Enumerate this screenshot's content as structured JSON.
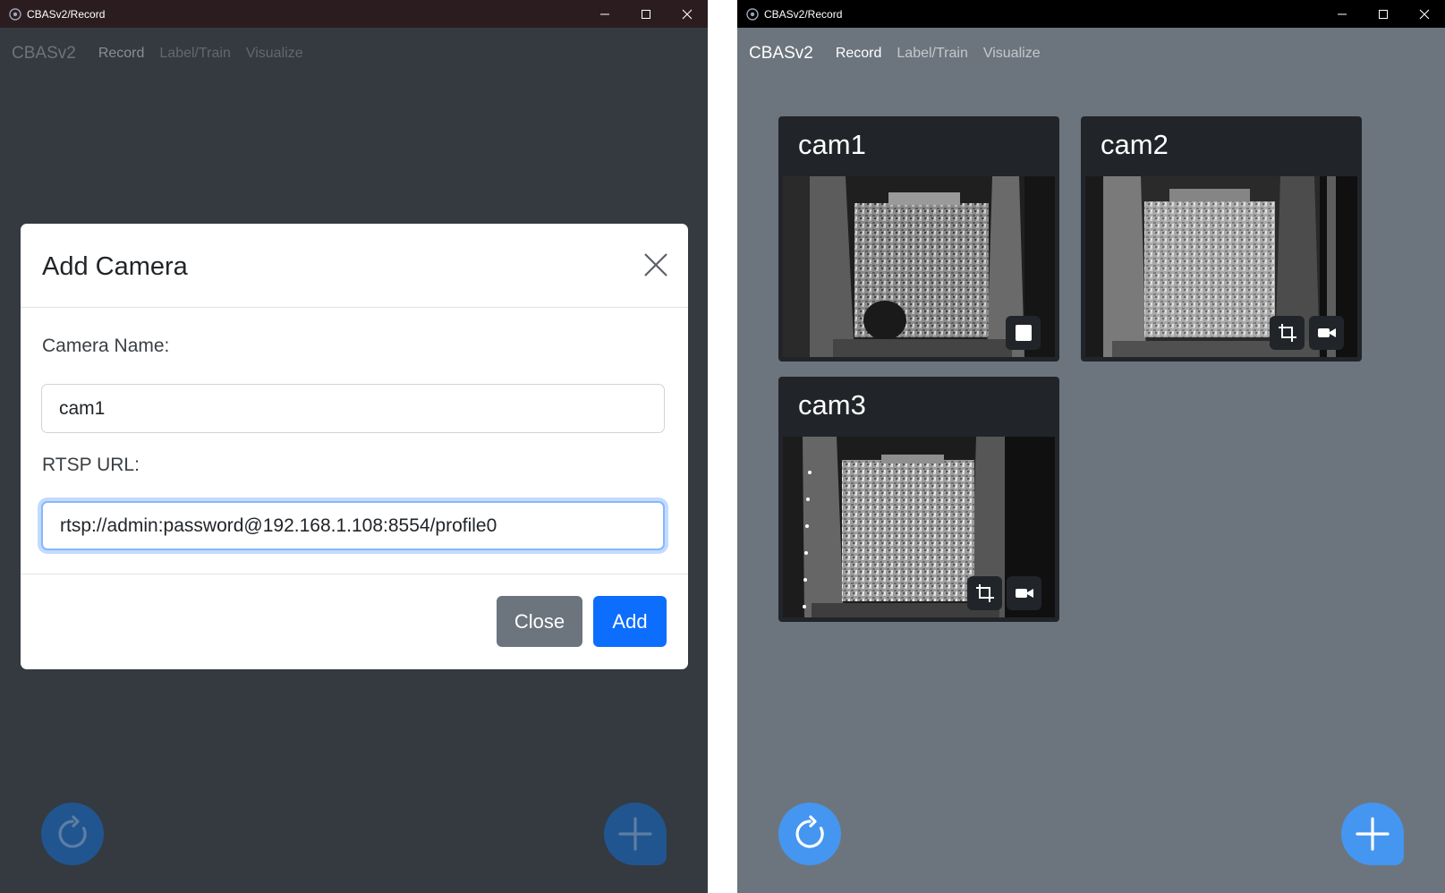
{
  "window_title": "CBASv2/Record",
  "navbar": {
    "brand": "CBASv2",
    "links": [
      "Record",
      "Label/Train",
      "Visualize"
    ]
  },
  "modal": {
    "title": "Add Camera",
    "camera_name_label": "Camera Name:",
    "camera_name_value": "cam1",
    "rtsp_label": "RTSP URL:",
    "rtsp_value": "rtsp://admin:password@192.168.1.108:8554/profile0",
    "close_label": "Close",
    "add_label": "Add"
  },
  "cameras": [
    {
      "name": "cam1",
      "recording": true
    },
    {
      "name": "cam2",
      "recording": false
    },
    {
      "name": "cam3",
      "recording": false
    }
  ],
  "colors": {
    "left_background": "#343a40",
    "right_background": "#6c757d",
    "card_background": "#212529",
    "primary": "#0d6efd",
    "secondary": "#6c757d",
    "fab": "#4596f0"
  },
  "icons": [
    "app-icon",
    "minimize-icon",
    "maximize-icon",
    "close-icon",
    "refresh-icon",
    "plus-icon",
    "stop-icon",
    "crop-icon",
    "video-camera-icon"
  ]
}
